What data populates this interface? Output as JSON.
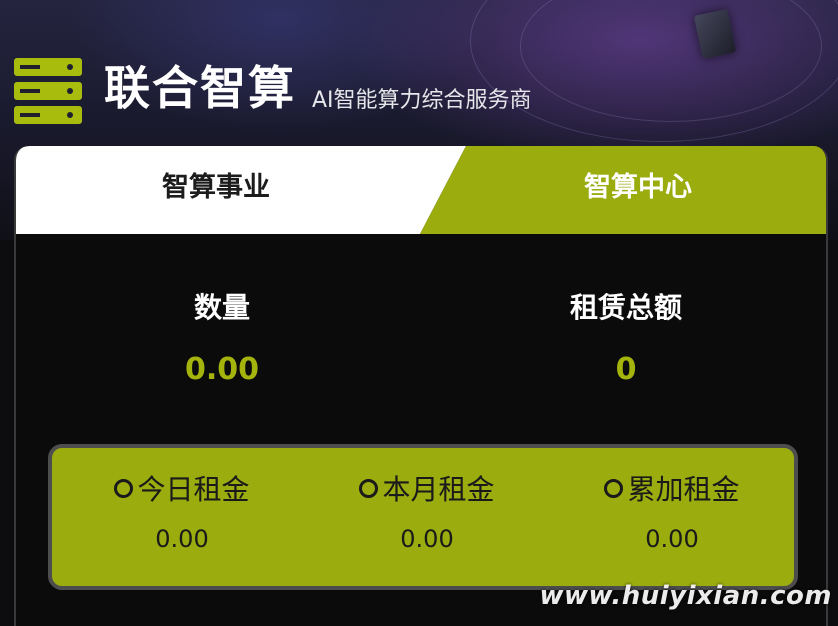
{
  "header": {
    "logo_icon": "server-stack-icon",
    "title": "联合智算",
    "subtitle": "AI智能算力综合服务商"
  },
  "tabs": [
    {
      "label": "智算事业",
      "active": false
    },
    {
      "label": "智算中心",
      "active": true
    }
  ],
  "stats": {
    "quantity_label": "数量",
    "quantity_value": "0.00",
    "total_label": "租赁总额",
    "total_value": "0"
  },
  "rent": {
    "today_label": "今日租金",
    "today_value": "0.00",
    "month_label": "本月租金",
    "month_value": "0.00",
    "cumulative_label": "累加租金",
    "cumulative_value": "0.00"
  },
  "watermark": "www.huiyixian.com",
  "colors": {
    "accent": "#9aac0e",
    "value_text": "#a4b40c",
    "background": "#0b0b0b"
  }
}
